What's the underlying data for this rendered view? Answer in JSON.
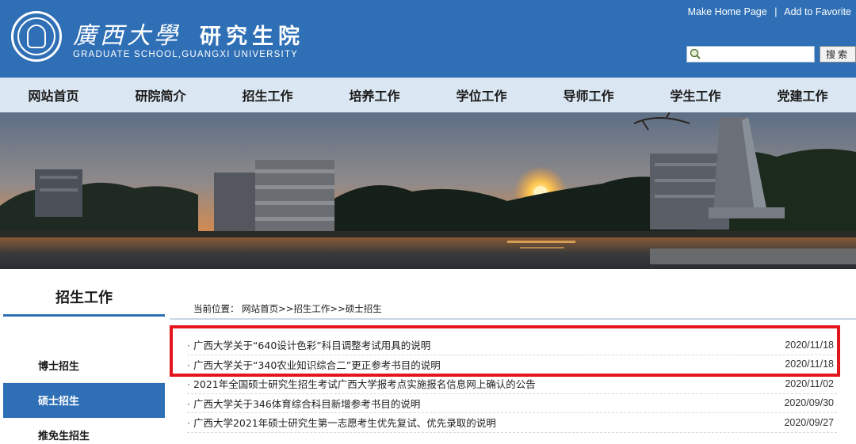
{
  "header": {
    "uni_name": "廣西大學",
    "school_name": "研究生院",
    "en_name": "GRADUATE SCHOOL,GUANGXI UNIVERSITY",
    "home_link": "Make Home Page",
    "separator": "|",
    "favorite_link": "Add to Favorite",
    "search_placeholder": "",
    "search_button": "搜索"
  },
  "nav": {
    "items": [
      "网站首页",
      "研院简介",
      "招生工作",
      "培养工作",
      "学位工作",
      "导师工作",
      "学生工作",
      "党建工作"
    ]
  },
  "sidebar": {
    "title": "招生工作",
    "items": [
      {
        "label": "博士招生",
        "active": false
      },
      {
        "label": "硕士招生",
        "active": true
      },
      {
        "label": "推免生招生",
        "active": false
      }
    ]
  },
  "breadcrumb": {
    "prefix": "当前位置：",
    "path": "网站首页>>招生工作>>硕士招生"
  },
  "news": [
    {
      "title": "广西大学关于“640设计色彩”科目调整考试用具的说明",
      "date": "2020/11/18"
    },
    {
      "title": "广西大学关于“340农业知识综合二”更正参考书目的说明",
      "date": "2020/11/18"
    },
    {
      "title": "2021年全国硕士研究生招生考试广西大学报考点实施报名信息网上确认的公告",
      "date": "2020/11/02"
    },
    {
      "title": "广西大学关于346体育综合科目新增参考书目的说明",
      "date": "2020/09/30"
    },
    {
      "title": "广西大学2021年硕士研究生第一志愿考生优先复试、优先录取的说明",
      "date": "2020/09/27"
    }
  ],
  "colors": {
    "header_blue": "#2f6fb6",
    "nav_bg": "#dae6f1",
    "highlight_red": "#e3151d"
  },
  "icons": {
    "logo": "university-seal-icon",
    "search": "search-icon"
  }
}
